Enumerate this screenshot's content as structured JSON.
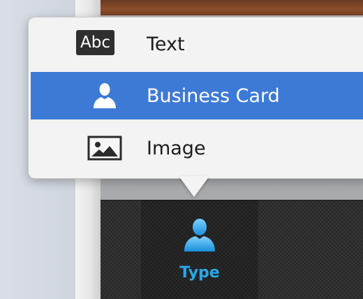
{
  "menu": {
    "items": [
      {
        "icon": "abc-text-icon",
        "badge": "Abc",
        "label": "Text",
        "selected": false
      },
      {
        "icon": "person-icon",
        "label": "Business Card",
        "selected": true
      },
      {
        "icon": "image-icon",
        "label": "Image",
        "selected": false
      }
    ]
  },
  "toolbar": {
    "type_label": "Type"
  },
  "colors": {
    "selection": "#3d7ad6",
    "accent": "#29a8e8",
    "toolbar_bg": "#2b2b2b"
  }
}
